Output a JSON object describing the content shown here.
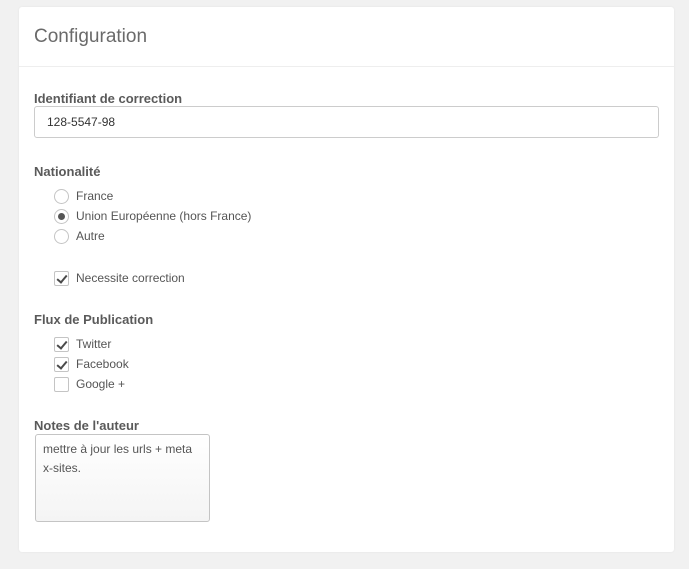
{
  "panel": {
    "title": "Configuration"
  },
  "correction_id": {
    "label": "Identifiant de correction",
    "value": "128-5547-98"
  },
  "nationality": {
    "label": "Nationalité",
    "options": [
      {
        "label": "France",
        "checked": false
      },
      {
        "label": "Union Européenne (hors France)",
        "checked": true
      },
      {
        "label": "Autre",
        "checked": false
      }
    ]
  },
  "needs_correction": {
    "label": "Necessite correction",
    "checked": true
  },
  "publication": {
    "label": "Flux de Publication",
    "options": [
      {
        "label": "Twitter",
        "checked": true
      },
      {
        "label": "Facebook",
        "checked": true
      },
      {
        "label": "Google +",
        "checked": false
      }
    ]
  },
  "author_notes": {
    "label": "Notes de l'auteur",
    "value": "mettre à jour les urls + meta x-sites."
  }
}
